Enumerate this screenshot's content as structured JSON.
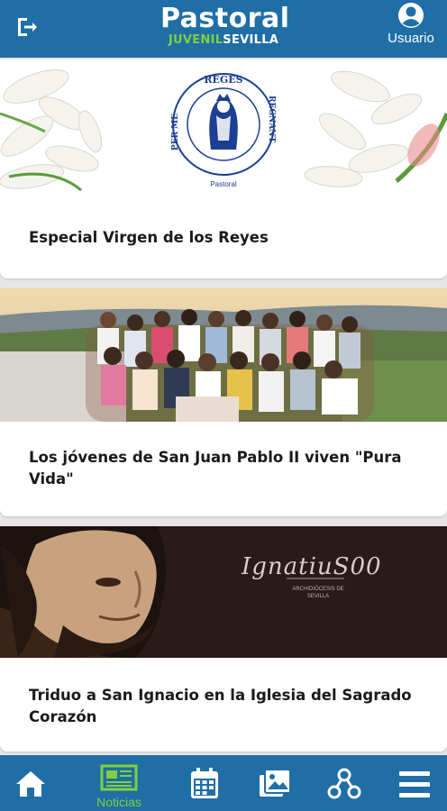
{
  "header": {
    "logo_main_1": "Pas",
    "logo_main_2": "toral",
    "logo_sub_a": "JUVENIL",
    "logo_sub_b": "SEVILLA",
    "user_label": "Usuario"
  },
  "seal": {
    "top": "REGES",
    "left": "PER  ME",
    "right": "REGNANT",
    "caption": "Pastoral"
  },
  "cards": [
    {
      "title": "Especial Virgen de los Reyes"
    },
    {
      "title": "Los jóvenes de San Juan Pablo II viven \"Pura Vida\""
    },
    {
      "title": "Triduo a San Ignacio en la Iglesia del Sagrado Corazón"
    }
  ],
  "ignatius": {
    "logo": "IgnatiuS00",
    "sub": "ARCHIDIÓCESIS DE SEVILLA"
  },
  "nav": {
    "active_label": "Noticias"
  },
  "colors": {
    "primary": "#1f6ea6",
    "accent": "#7fd03c"
  }
}
